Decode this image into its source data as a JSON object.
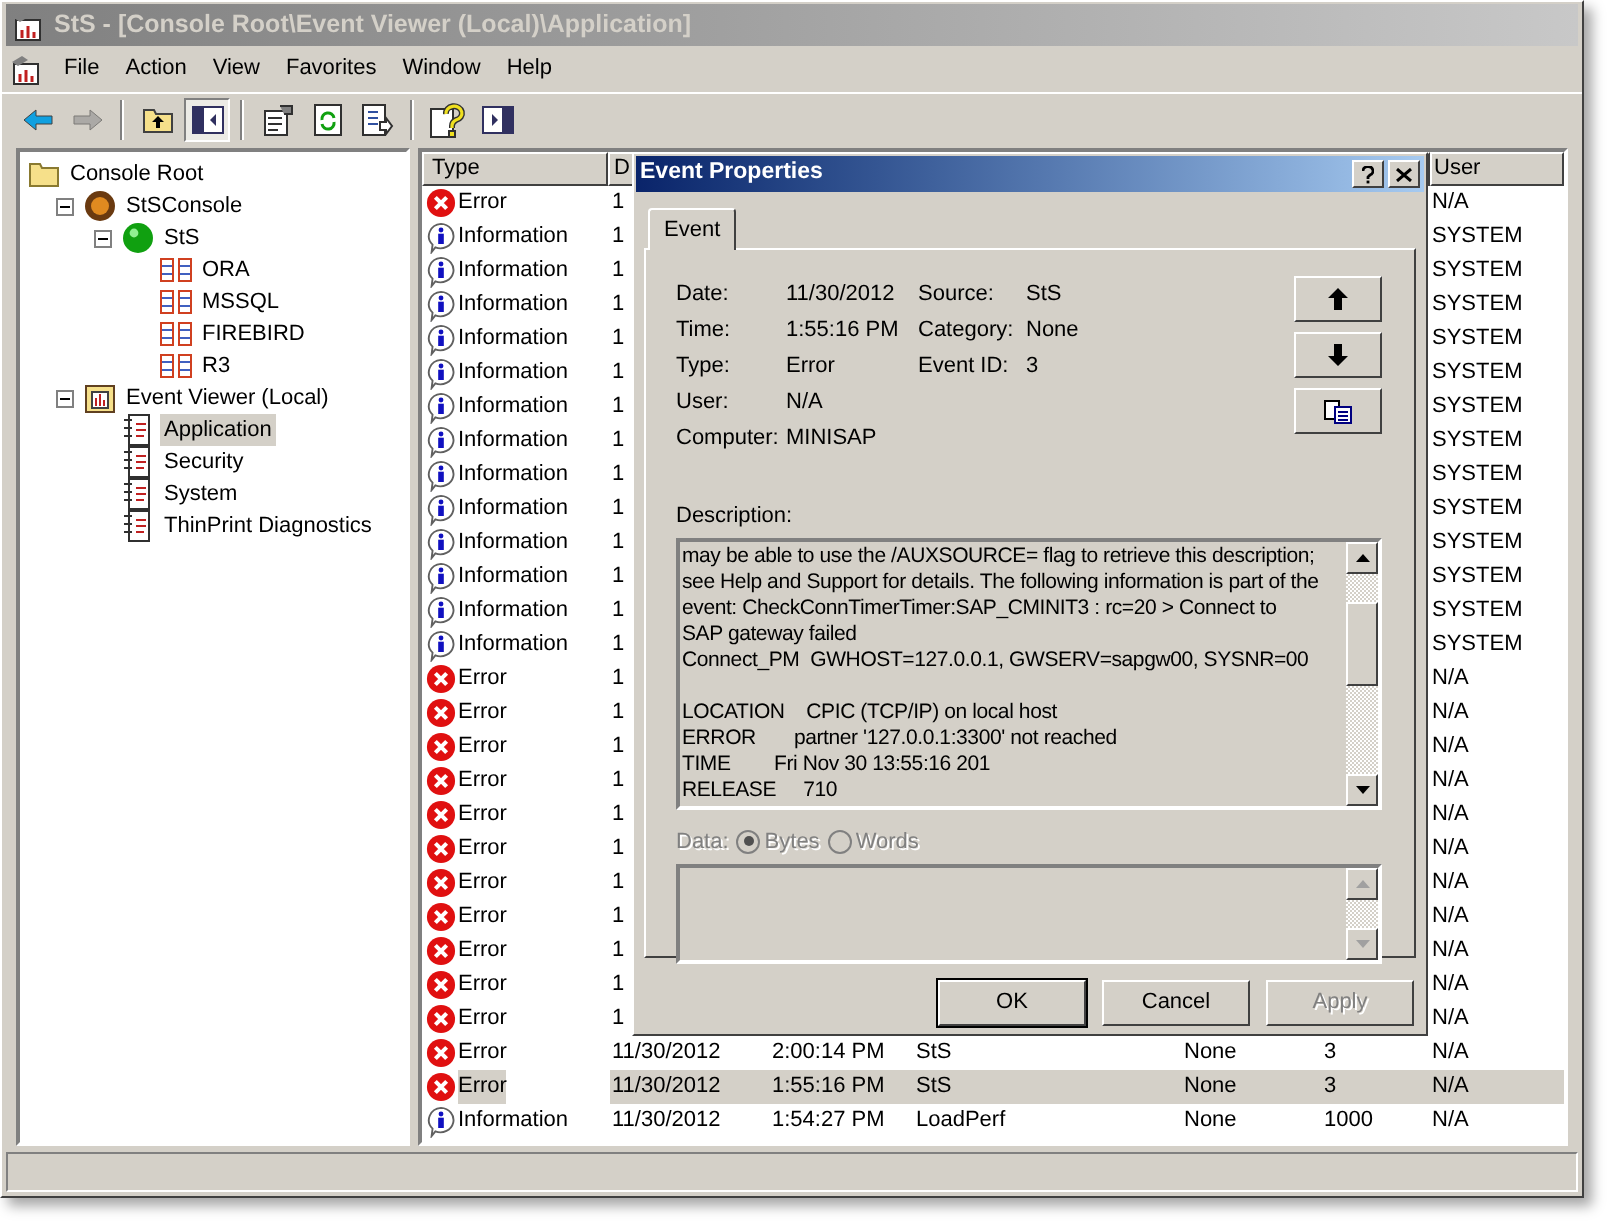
{
  "window": {
    "title": "StS - [Console Root\\Event Viewer (Local)\\Application]",
    "active": false
  },
  "menu": [
    "File",
    "Action",
    "View",
    "Favorites",
    "Window",
    "Help"
  ],
  "toolbar": [
    [
      {
        "kind": "back",
        "disabled": false,
        "pressed": false
      },
      {
        "kind": "forward",
        "disabled": true,
        "pressed": false
      }
    ],
    [
      {
        "kind": "up",
        "disabled": false,
        "pressed": false
      },
      {
        "kind": "tree",
        "disabled": false,
        "pressed": true
      }
    ],
    [
      {
        "kind": "properties",
        "disabled": false,
        "pressed": false
      },
      {
        "kind": "refresh",
        "disabled": false,
        "pressed": false
      },
      {
        "kind": "export",
        "disabled": false,
        "pressed": false
      }
    ],
    [
      {
        "kind": "help",
        "disabled": false,
        "pressed": false
      },
      {
        "kind": "pane",
        "disabled": false,
        "pressed": false
      }
    ]
  ],
  "tree": [
    {
      "label": "Console Root",
      "kind": "folder",
      "selected": false,
      "children": [
        {
          "label": "StSConsole",
          "kind": "console",
          "expanded": true,
          "selected": false,
          "children": [
            {
              "label": "StS",
              "kind": "server",
              "expanded": true,
              "selected": false,
              "children": [
                {
                  "label": "ORA",
                  "kind": "database",
                  "selected": false
                },
                {
                  "label": "MSSQL",
                  "kind": "database",
                  "selected": false
                },
                {
                  "label": "FIREBIRD",
                  "kind": "database",
                  "selected": false
                },
                {
                  "label": "R3",
                  "kind": "database",
                  "selected": false
                }
              ]
            }
          ]
        },
        {
          "label": "Event Viewer (Local)",
          "kind": "viewer",
          "expanded": true,
          "selected": false,
          "children": [
            {
              "label": "Application",
              "kind": "log",
              "selected": true
            },
            {
              "label": "Security",
              "kind": "log",
              "selected": false
            },
            {
              "label": "System",
              "kind": "log",
              "selected": false
            },
            {
              "label": "ThinPrint Diagnostics",
              "kind": "log",
              "selected": false
            }
          ]
        }
      ]
    }
  ],
  "table": {
    "columns": [
      "Type",
      "D",
      "User"
    ],
    "rows": [
      {
        "kind": "error",
        "type": "Error",
        "date": "1",
        "user": "N/A",
        "selected": false
      },
      {
        "kind": "info",
        "type": "Information",
        "date": "1",
        "user": "SYSTEM",
        "selected": false
      },
      {
        "kind": "info",
        "type": "Information",
        "date": "1",
        "user": "SYSTEM",
        "selected": false
      },
      {
        "kind": "info",
        "type": "Information",
        "date": "1",
        "user": "SYSTEM",
        "selected": false
      },
      {
        "kind": "info",
        "type": "Information",
        "date": "1",
        "user": "SYSTEM",
        "selected": false
      },
      {
        "kind": "info",
        "type": "Information",
        "date": "1",
        "user": "SYSTEM",
        "selected": false
      },
      {
        "kind": "info",
        "type": "Information",
        "date": "1",
        "user": "SYSTEM",
        "selected": false
      },
      {
        "kind": "info",
        "type": "Information",
        "date": "1",
        "user": "SYSTEM",
        "selected": false
      },
      {
        "kind": "info",
        "type": "Information",
        "date": "1",
        "user": "SYSTEM",
        "selected": false
      },
      {
        "kind": "info",
        "type": "Information",
        "date": "1",
        "user": "SYSTEM",
        "selected": false
      },
      {
        "kind": "info",
        "type": "Information",
        "date": "1",
        "user": "SYSTEM",
        "selected": false
      },
      {
        "kind": "info",
        "type": "Information",
        "date": "1",
        "user": "SYSTEM",
        "selected": false
      },
      {
        "kind": "info",
        "type": "Information",
        "date": "1",
        "user": "SYSTEM",
        "selected": false
      },
      {
        "kind": "info",
        "type": "Information",
        "date": "1",
        "user": "SYSTEM",
        "selected": false
      },
      {
        "kind": "error",
        "type": "Error",
        "date": "1",
        "user": "N/A",
        "selected": false
      },
      {
        "kind": "error",
        "type": "Error",
        "date": "1",
        "user": "N/A",
        "selected": false
      },
      {
        "kind": "error",
        "type": "Error",
        "date": "1",
        "user": "N/A",
        "selected": false
      },
      {
        "kind": "error",
        "type": "Error",
        "date": "1",
        "user": "N/A",
        "selected": false
      },
      {
        "kind": "error",
        "type": "Error",
        "date": "1",
        "user": "N/A",
        "selected": false
      },
      {
        "kind": "error",
        "type": "Error",
        "date": "1",
        "user": "N/A",
        "selected": false
      },
      {
        "kind": "error",
        "type": "Error",
        "date": "1",
        "user": "N/A",
        "selected": false
      },
      {
        "kind": "error",
        "type": "Error",
        "date": "1",
        "user": "N/A",
        "selected": false
      },
      {
        "kind": "error",
        "type": "Error",
        "date": "1",
        "user": "N/A",
        "selected": false
      },
      {
        "kind": "error",
        "type": "Error",
        "date": "1",
        "user": "N/A",
        "selected": false
      },
      {
        "kind": "error",
        "type": "Error",
        "date": "1",
        "user": "N/A",
        "selected": false
      },
      {
        "kind": "error",
        "type": "Error",
        "date": "11/30/2012",
        "time": "2:00:14 PM",
        "source": "StS",
        "category": "None",
        "event": "3",
        "user": "N/A",
        "selected": false
      },
      {
        "kind": "error",
        "type": "Error",
        "date": "11/30/2012",
        "time": "1:55:16 PM",
        "source": "StS",
        "category": "None",
        "event": "3",
        "user": "N/A",
        "selected": true
      },
      {
        "kind": "info",
        "type": "Information",
        "date": "11/30/2012",
        "time": "1:54:27 PM",
        "source": "LoadPerf",
        "category": "None",
        "event": "1000",
        "user": "N/A",
        "selected": false
      }
    ]
  },
  "dialog": {
    "title": "Event Properties",
    "tabs": [
      {
        "label": "Event",
        "selected": true
      }
    ],
    "fields": [
      {
        "label": "Date:",
        "value": "11/30/2012"
      },
      {
        "label": "Time:",
        "value": "1:55:16 PM"
      },
      {
        "label": "Type:",
        "value": "Error"
      },
      {
        "label": "User:",
        "value": "N/A"
      },
      {
        "label": "Computer:",
        "value": "MINISAP"
      }
    ],
    "fields_right": [
      {
        "label": "Source:",
        "value": "StS"
      },
      {
        "label": "Category:",
        "value": "None"
      },
      {
        "label": "Event ID:",
        "value": "3"
      }
    ],
    "description_label": "Description:",
    "description_blocks": [
      [
        "may be able to use the /AUXSOURCE= flag to retrieve this description;",
        "see Help and Support for details. The following information is part of the",
        "event: CheckConnTimerTimer:SAP_CMINIT3 : rc=20 > Connect to",
        "SAP gateway failed",
        "Connect_PM  GWHOST=127.0.0.1, GWSERV=sapgw00, SYSNR=00"
      ],
      [
        "LOCATION    CPIC (TCP/IP) on local host",
        "ERROR       partner '127.0.0.1:3300' not reached",
        "TIME        Fri Nov 30 13:55:16 201",
        "RELEASE     710"
      ]
    ],
    "data_label": "Data:",
    "data_disabled": true,
    "data_format": [
      {
        "label": "Bytes",
        "selected": true
      },
      {
        "label": "Words",
        "selected": false
      }
    ],
    "buttons": [
      {
        "label": "OK",
        "default": true,
        "disabled": false
      },
      {
        "label": "Cancel",
        "default": false,
        "disabled": false
      },
      {
        "label": "Apply",
        "default": false,
        "disabled": true
      }
    ]
  }
}
